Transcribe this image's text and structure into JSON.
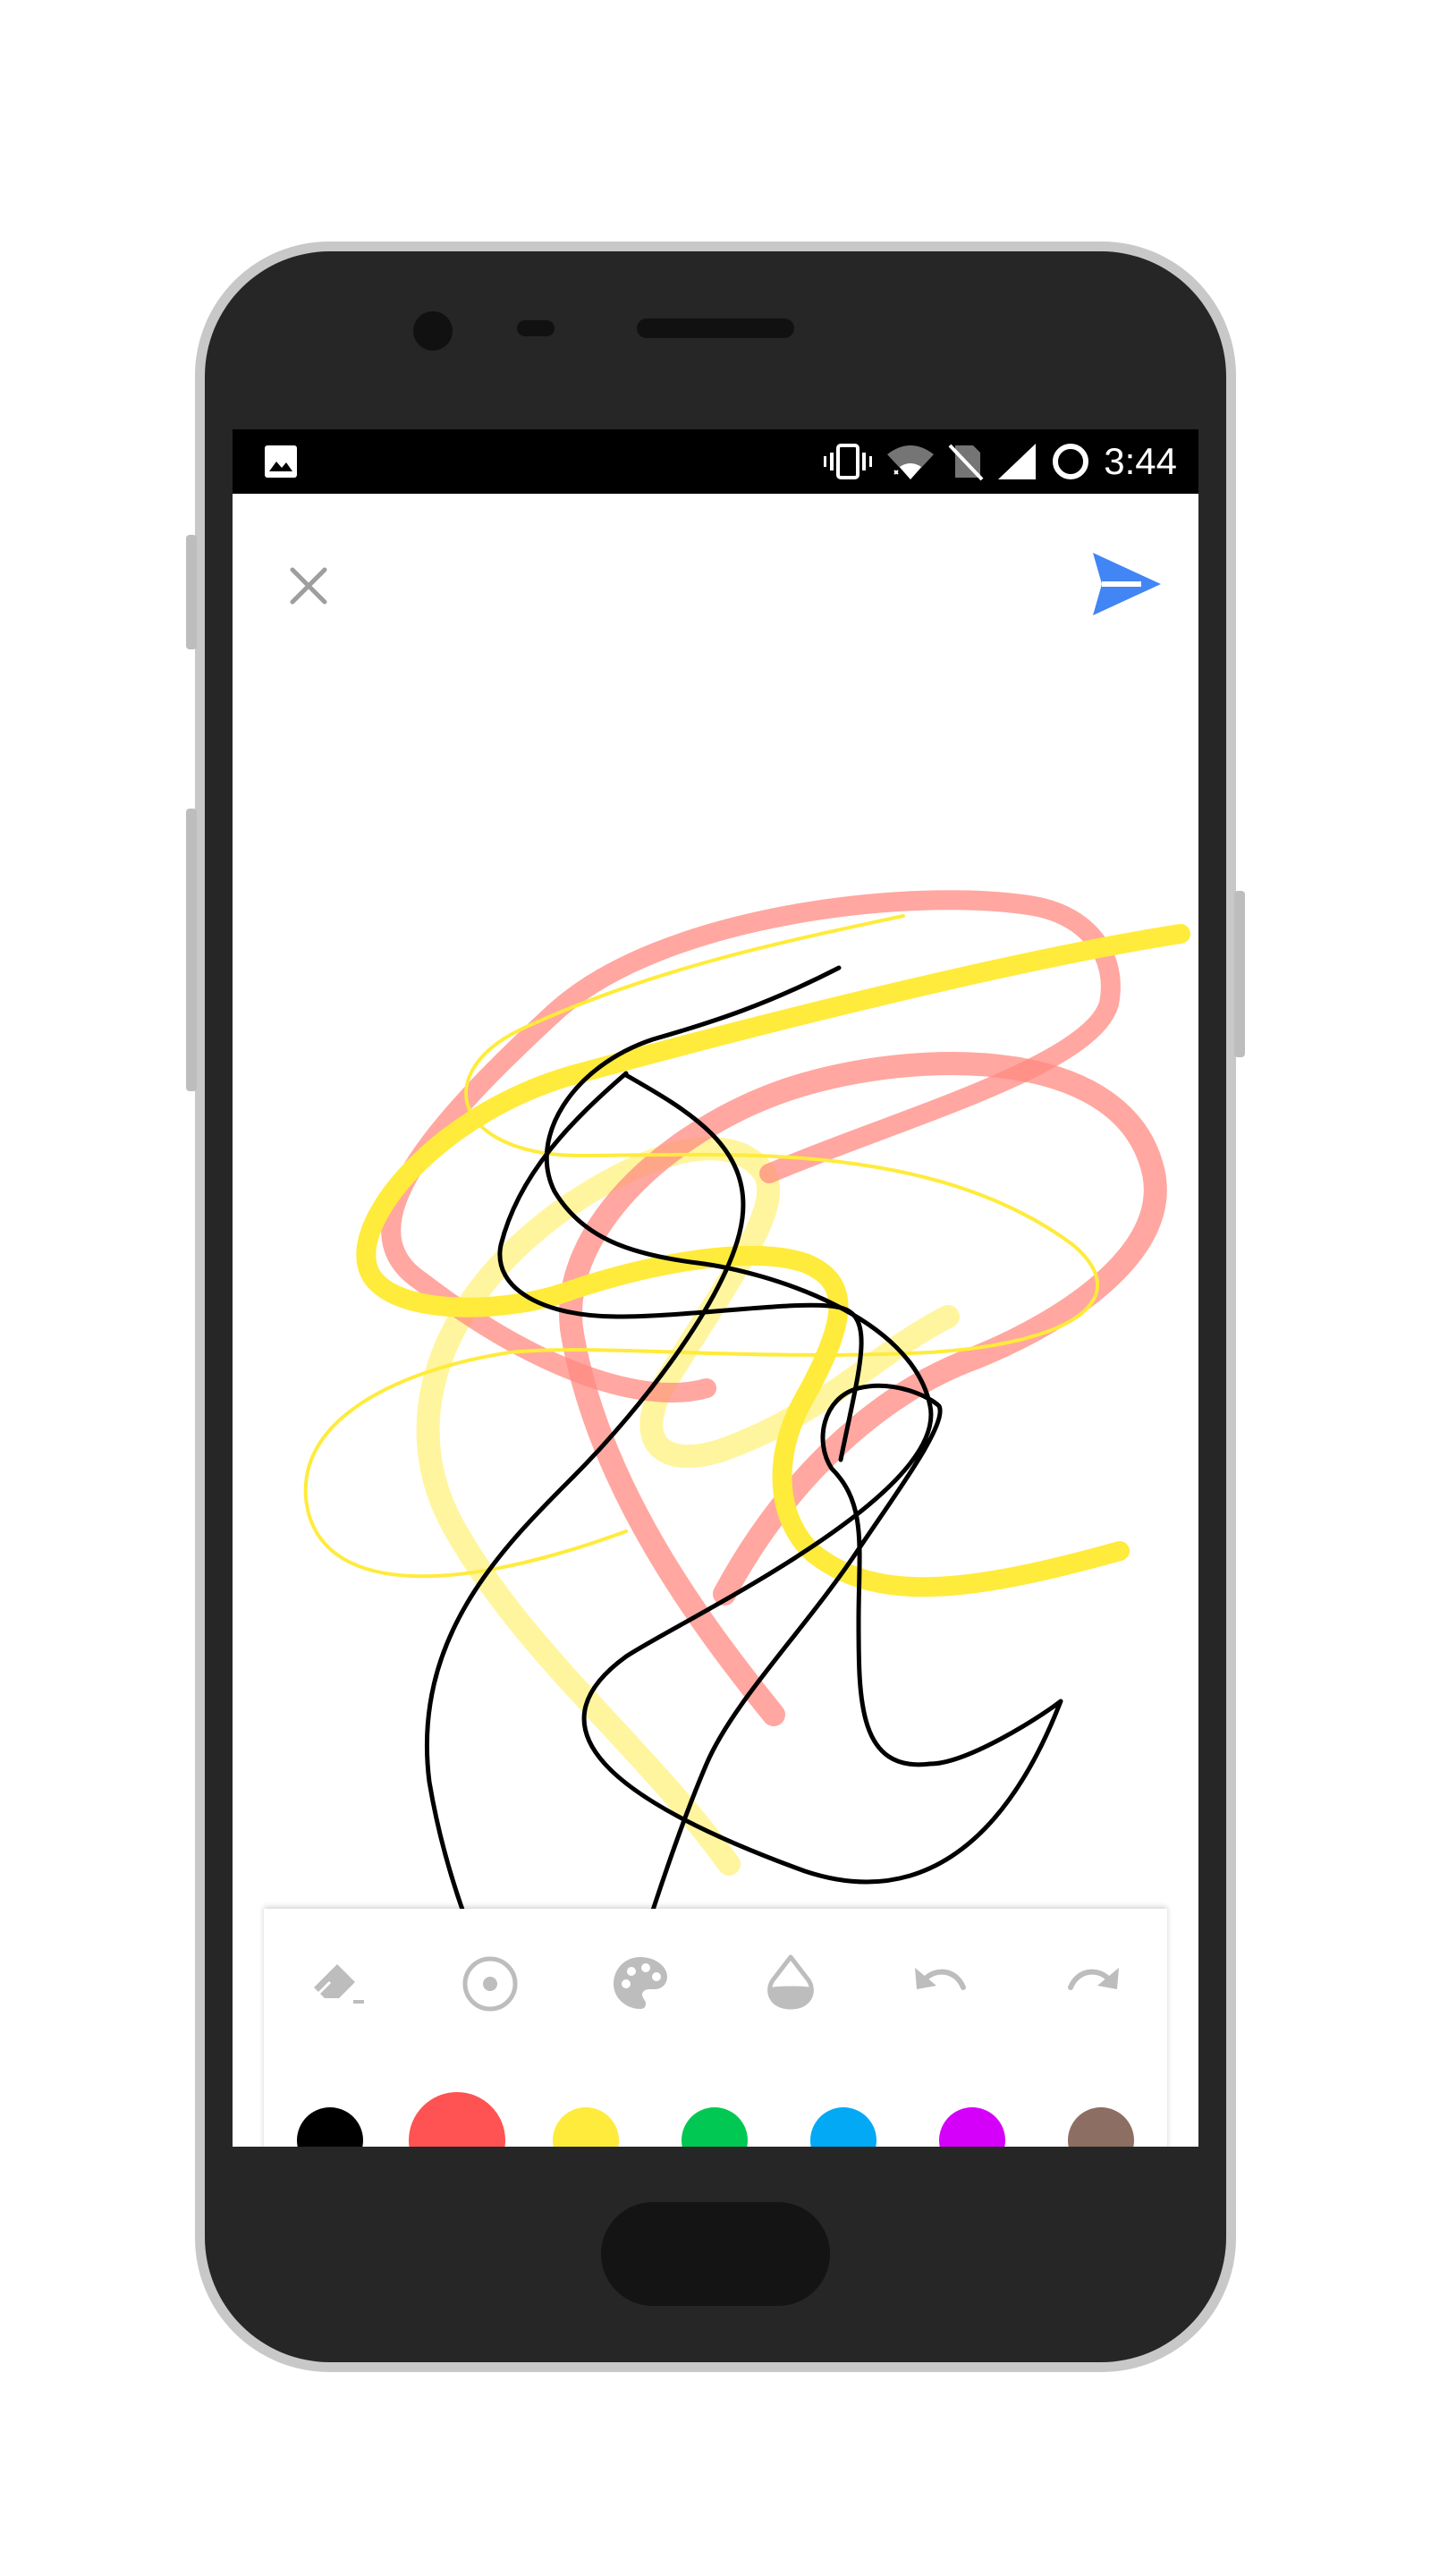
{
  "status_bar": {
    "time": "3:44",
    "icons": [
      "gallery-icon",
      "vibrate-icon",
      "wifi-icon",
      "no-sim-icon",
      "signal-icon",
      "sync-icon"
    ]
  },
  "header": {
    "close_icon": "close-icon",
    "send_icon": "send-icon",
    "send_color": "#4285F4",
    "close_color": "#9e9e9e"
  },
  "toolbar": {
    "tools": [
      "eraser-icon",
      "brush-size-icon",
      "palette-icon",
      "opacity-icon",
      "undo-icon",
      "redo-icon"
    ],
    "colors": [
      {
        "name": "black",
        "hex": "#000000"
      },
      {
        "name": "red",
        "hex": "#FF5252",
        "selected": true
      },
      {
        "name": "yellow",
        "hex": "#FFEB3B"
      },
      {
        "name": "green",
        "hex": "#00C853"
      },
      {
        "name": "blue",
        "hex": "#03A9F4"
      },
      {
        "name": "purple",
        "hex": "#D500F9"
      },
      {
        "name": "brown",
        "hex": "#8D6E63"
      }
    ]
  },
  "drawing": {
    "stroke_colors": [
      "#FF5252",
      "#FFEB3B",
      "#000000"
    ]
  }
}
